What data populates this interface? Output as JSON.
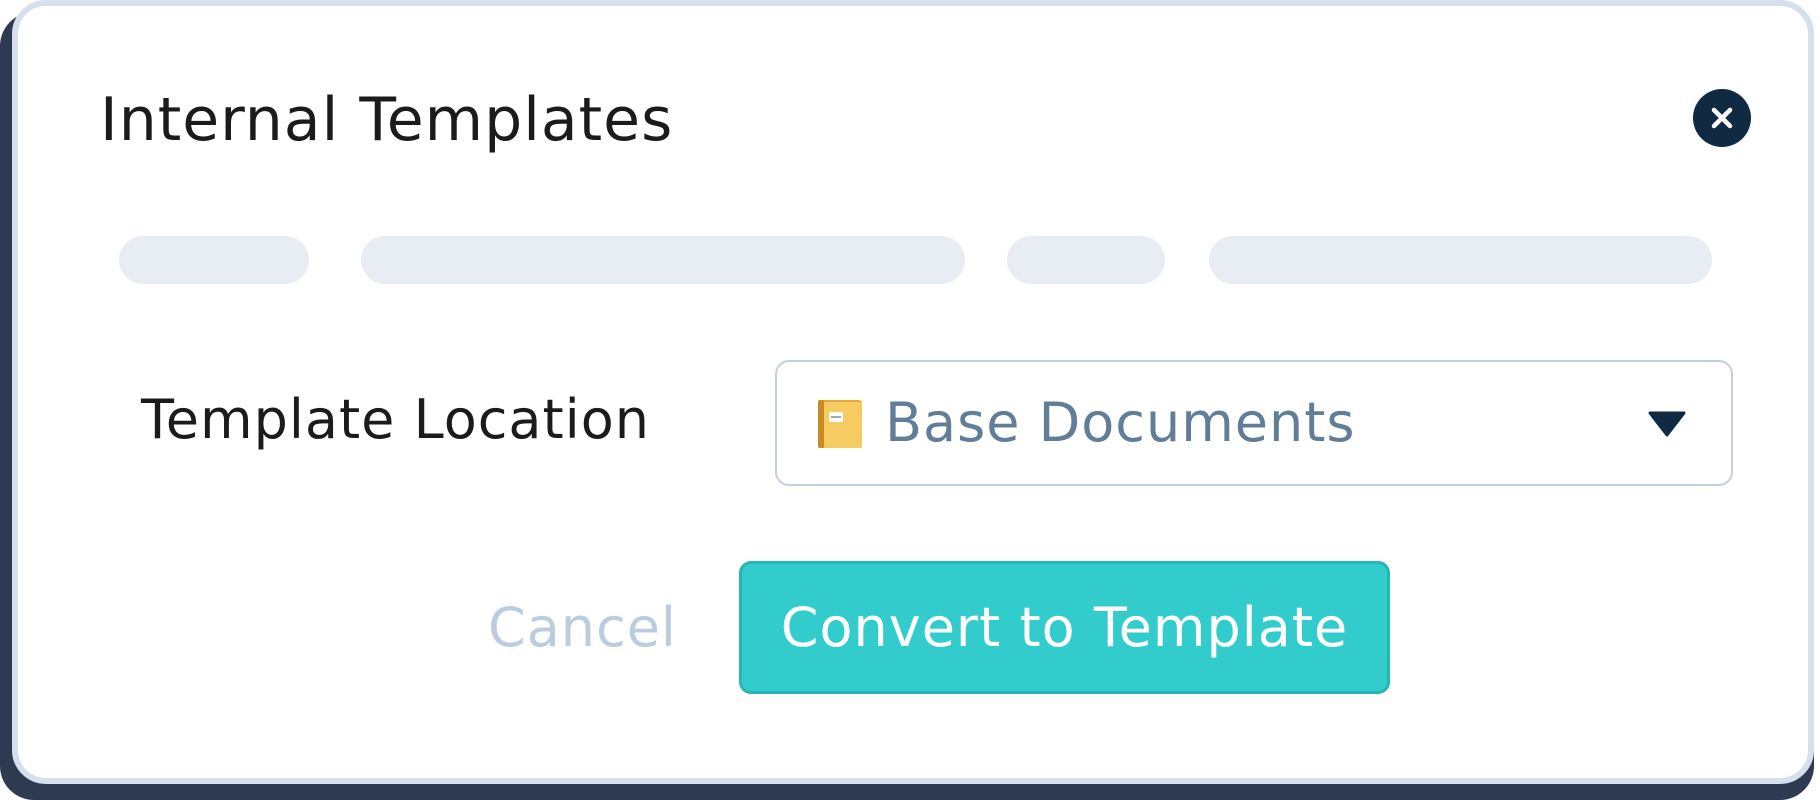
{
  "modal": {
    "title": "Internal Templates",
    "close_icon": "close-icon"
  },
  "form": {
    "location_label": "Template Location",
    "location_select": {
      "icon": "folder-icon",
      "selected": "Base Documents",
      "arrow_icon": "chevron-down-icon"
    }
  },
  "actions": {
    "cancel_label": "Cancel",
    "convert_label": "Convert to Template"
  },
  "colors": {
    "primary": "#33cccc",
    "dark": "#102a43",
    "muted_text": "#627d98",
    "cancel_text": "#bccce0",
    "skeleton": "#e8edf3"
  }
}
